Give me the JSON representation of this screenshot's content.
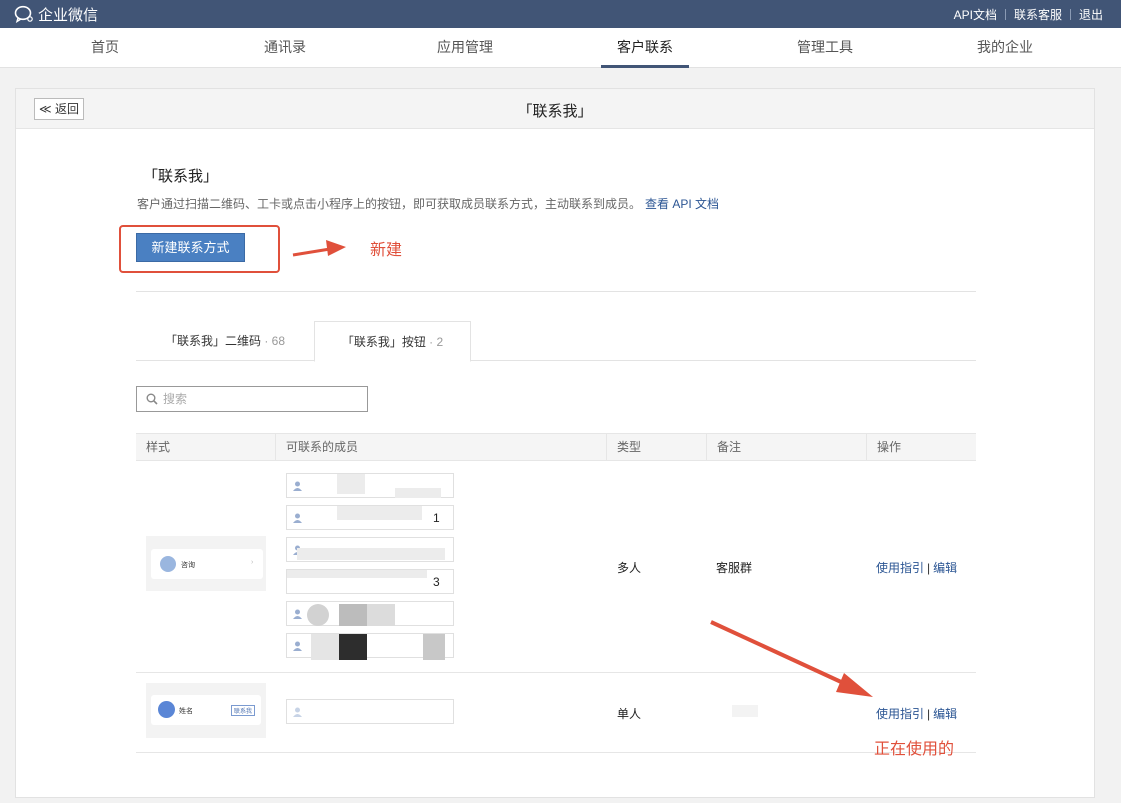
{
  "topbar": {
    "logo_text": "企业微信",
    "links": [
      "API文档",
      "联系客服",
      "退出"
    ]
  },
  "nav": {
    "items": [
      "首页",
      "通讯录",
      "应用管理",
      "客户联系",
      "管理工具",
      "我的企业"
    ],
    "active_index": 3
  },
  "card": {
    "back_label": "≪ 返回",
    "title": "「联系我」"
  },
  "section": {
    "title": "「联系我」",
    "description": "客户通过扫描二维码、工卡或点击小程序上的按钮，即可获取成员联系方式，主动联系到成员。",
    "doc_link": "查看 API 文档",
    "new_button": "新建联系方式"
  },
  "annotations": {
    "new_label": "新建",
    "in_use_label": "正在使用的",
    "color": "#e0503b"
  },
  "tabs": [
    {
      "label": "「联系我」二维码",
      "count": " · 68"
    },
    {
      "label": "「联系我」按钮",
      "count": " · 2"
    }
  ],
  "tabs_active_index": 1,
  "search": {
    "placeholder": "搜索"
  },
  "table": {
    "headers": [
      "样式",
      "可联系的成员",
      "类型",
      "备注",
      "操作"
    ],
    "rows": [
      {
        "preview_text": "咨询",
        "member_partial": [
          "",
          "1",
          "",
          "3",
          "",
          ""
        ],
        "type": "多人",
        "note": "客服群",
        "op_guide": "使用指引",
        "op_edit": "编辑"
      },
      {
        "preview_text": "姓名",
        "preview_badge": "联系我",
        "member_partial": [
          ""
        ],
        "type": "单人",
        "note": "",
        "op_guide": "使用指引",
        "op_edit": "编辑"
      }
    ]
  },
  "colors": {
    "topbar": "#415576",
    "link": "#2b5593",
    "primary_button": "#4a80c2"
  }
}
